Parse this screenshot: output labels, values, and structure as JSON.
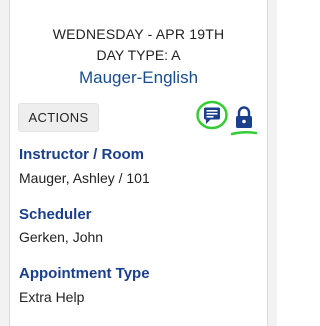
{
  "header": {
    "date": "WEDNESDAY - APR 19TH",
    "day_type": "DAY TYPE: A",
    "course": "Mauger-English"
  },
  "toolbar": {
    "actions_label": "ACTIONS",
    "chat_icon": "chat-message-icon",
    "lock_icon": "lock-icon"
  },
  "details": [
    {
      "label": "Instructor / Room",
      "value": "Mauger, Ashley / 101"
    },
    {
      "label": "Scheduler",
      "value": "Gerken, John"
    },
    {
      "label": "Appointment Type",
      "value": "Extra Help"
    }
  ],
  "colors": {
    "accent": "#1a3f8c",
    "link": "#1a4d8f",
    "annotation": "#33cc33"
  }
}
